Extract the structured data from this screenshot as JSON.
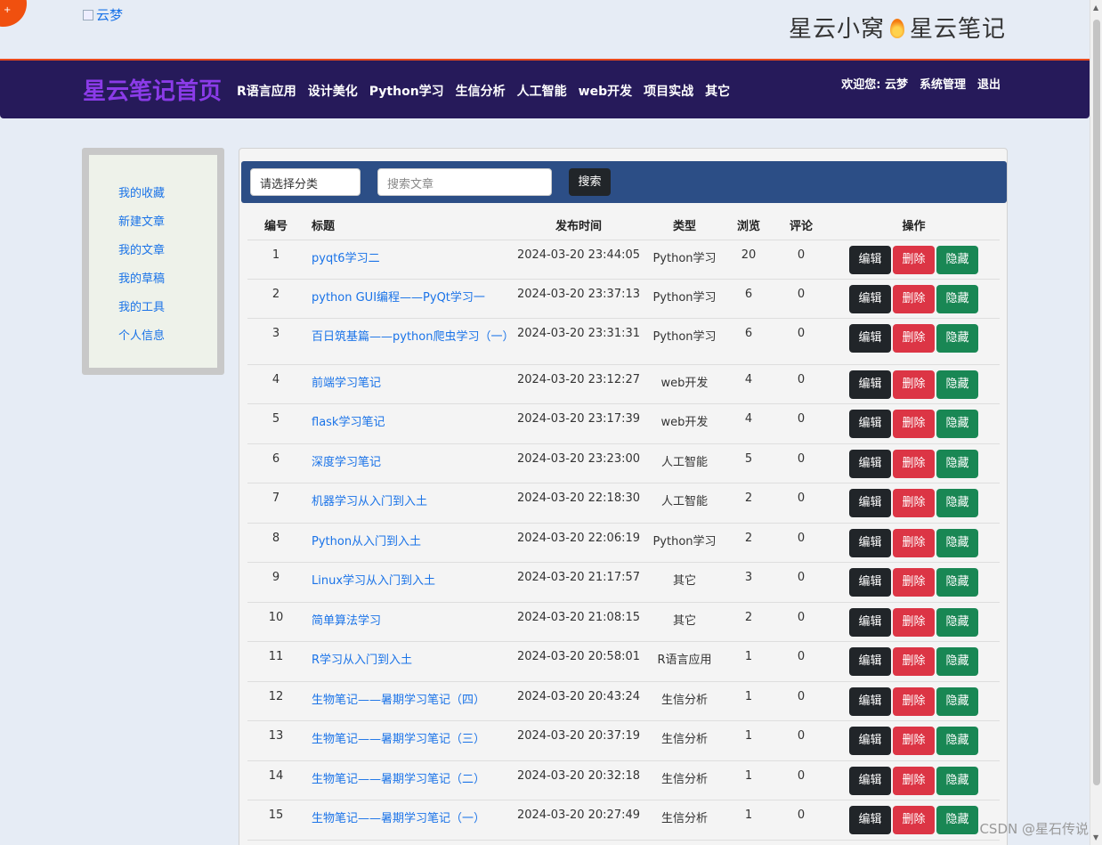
{
  "header": {
    "brand_link": "云梦",
    "slogan_left": "星云小窝",
    "slogan_right": "星云笔记"
  },
  "navbar": {
    "brand": "星云笔记首页",
    "items": [
      "R语言应用",
      "设计美化",
      "Python学习",
      "生信分析",
      "人工智能",
      "web开发",
      "项目实战",
      "其它"
    ],
    "welcome": "欢迎您: 云梦",
    "admin": "系统管理",
    "logout": "退出"
  },
  "sidebar": {
    "items": [
      "我的收藏",
      "新建文章",
      "我的文章",
      "我的草稿",
      "我的工具",
      "个人信息"
    ]
  },
  "search": {
    "category_placeholder": "请选择分类",
    "search_placeholder": "搜索文章",
    "button": "搜索"
  },
  "table": {
    "headers": [
      "编号",
      "标题",
      "发布时间",
      "类型",
      "浏览",
      "评论",
      "操作"
    ],
    "actions": {
      "edit": "编辑",
      "delete": "删除",
      "hide": "隐藏"
    },
    "rows": [
      {
        "id": "1",
        "title": "pyqt6学习二",
        "time": "2024-03-20 23:44:05",
        "type": "Python学习",
        "views": "20",
        "comments": "0"
      },
      {
        "id": "2",
        "title": "python GUI编程——PyQt学习一",
        "time": "2024-03-20 23:37:13",
        "type": "Python学习",
        "views": "6",
        "comments": "0"
      },
      {
        "id": "3",
        "title": "百日筑基篇——python爬虫学习（一）",
        "time": "2024-03-20 23:31:31",
        "type": "Python学习",
        "views": "6",
        "comments": "0"
      },
      {
        "id": "4",
        "title": "前端学习笔记",
        "time": "2024-03-20 23:12:27",
        "type": "web开发",
        "views": "4",
        "comments": "0"
      },
      {
        "id": "5",
        "title": "flask学习笔记",
        "time": "2024-03-20 23:17:39",
        "type": "web开发",
        "views": "4",
        "comments": "0"
      },
      {
        "id": "6",
        "title": "深度学习笔记",
        "time": "2024-03-20 23:23:00",
        "type": "人工智能",
        "views": "5",
        "comments": "0"
      },
      {
        "id": "7",
        "title": "机器学习从入门到入土",
        "time": "2024-03-20 22:18:30",
        "type": "人工智能",
        "views": "2",
        "comments": "0"
      },
      {
        "id": "8",
        "title": "Python从入门到入土",
        "time": "2024-03-20 22:06:19",
        "type": "Python学习",
        "views": "2",
        "comments": "0"
      },
      {
        "id": "9",
        "title": "Linux学习从入门到入土",
        "time": "2024-03-20 21:17:57",
        "type": "其它",
        "views": "3",
        "comments": "0"
      },
      {
        "id": "10",
        "title": "简单算法学习",
        "time": "2024-03-20 21:08:15",
        "type": "其它",
        "views": "2",
        "comments": "0"
      },
      {
        "id": "11",
        "title": "R学习从入门到入土",
        "time": "2024-03-20 20:58:01",
        "type": "R语言应用",
        "views": "1",
        "comments": "0"
      },
      {
        "id": "12",
        "title": "生物笔记——暑期学习笔记（四）",
        "time": "2024-03-20 20:43:24",
        "type": "生信分析",
        "views": "1",
        "comments": "0"
      },
      {
        "id": "13",
        "title": "生物笔记——暑期学习笔记（三）",
        "time": "2024-03-20 20:37:19",
        "type": "生信分析",
        "views": "1",
        "comments": "0"
      },
      {
        "id": "14",
        "title": "生物笔记——暑期学习笔记（二）",
        "time": "2024-03-20 20:32:18",
        "type": "生信分析",
        "views": "1",
        "comments": "0"
      },
      {
        "id": "15",
        "title": "生物笔记——暑期学习笔记（一）",
        "time": "2024-03-20 20:27:49",
        "type": "生信分析",
        "views": "1",
        "comments": "0"
      }
    ]
  },
  "watermark": "CSDN @星石传说",
  "colors": {
    "navbar": "#261a5a",
    "brand": "#8b3be8",
    "search_bar": "#2c4e86",
    "edit": "#212529",
    "delete": "#dc3545",
    "hide": "#198754",
    "link": "#1a73e8"
  }
}
